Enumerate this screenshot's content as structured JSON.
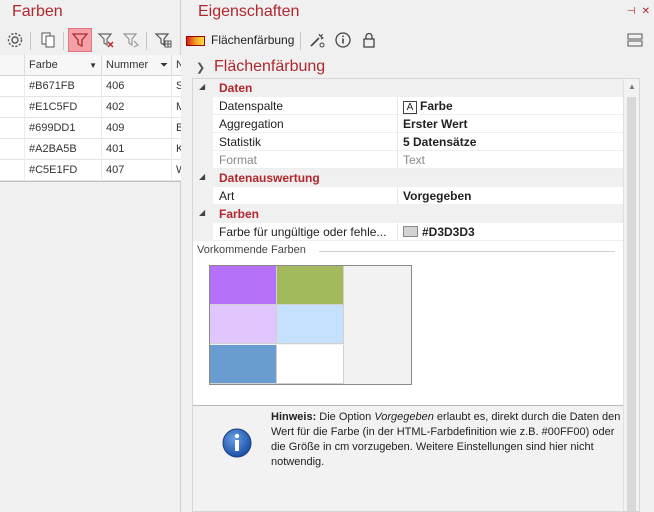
{
  "left_panel": {
    "title": "Farben",
    "columns": [
      "Farbe",
      "Nummer",
      "N"
    ],
    "rows": [
      {
        "farbe": "#B671FB",
        "nummer": "406",
        "n": "S"
      },
      {
        "farbe": "#E1C5FD",
        "nummer": "402",
        "n": "M"
      },
      {
        "farbe": "#699DD1",
        "nummer": "409",
        "n": "B"
      },
      {
        "farbe": "#A2BA5B",
        "nummer": "401",
        "n": "K"
      },
      {
        "farbe": "#C5E1FD",
        "nummer": "407",
        "n": "W"
      }
    ],
    "toolbar_icons": [
      "gear-icon",
      "copy-icon",
      "filter-icon",
      "filter-clear-icon",
      "filter-reset-icon",
      "filter-grid-icon"
    ]
  },
  "right_panel": {
    "title": "Eigenschaften",
    "toolbar_label": "Flächenfärbung",
    "section_title": "Flächenfärbung",
    "groups": {
      "daten": "Daten",
      "datenauswertung": "Datenauswertung",
      "farben": "Farben"
    },
    "props": {
      "datenspalte": {
        "name": "Datenspalte",
        "value": "Farbe",
        "type_glyph": "A"
      },
      "aggregation": {
        "name": "Aggregation",
        "value": "Erster Wert"
      },
      "statistik": {
        "name": "Statistik",
        "value": "5 Datensätze"
      },
      "format": {
        "name": "Format",
        "value": "Text"
      },
      "art": {
        "name": "Art",
        "value": "Vorgegeben"
      },
      "invalid_color": {
        "name": "Farbe für ungültige oder fehle...",
        "value": "#D3D3D3",
        "swatch": "#D3D3D3"
      }
    },
    "vorkommende_label": "Vorkommende Farben",
    "color_swatches": [
      "#B671FB",
      "#A2BA5B",
      "#E1C5FD",
      "#C5E1FD",
      "#699DD1",
      "#FFFFFF"
    ],
    "hint": {
      "bold": "Hinweis:",
      "pre": " Die Option ",
      "ital": "Vorgegeben",
      "post": " erlaubt es, direkt durch die Daten den Wert für die Farbe (in der HTML-Farbdefinition wie z.B. #00FF00) oder die Größe in cm vorzugeben. Weitere Einstellungen sind hier nicht notwendig."
    }
  },
  "colors": {
    "accent": "#B0272E",
    "active_filter_bg": "#F4A0A6"
  }
}
